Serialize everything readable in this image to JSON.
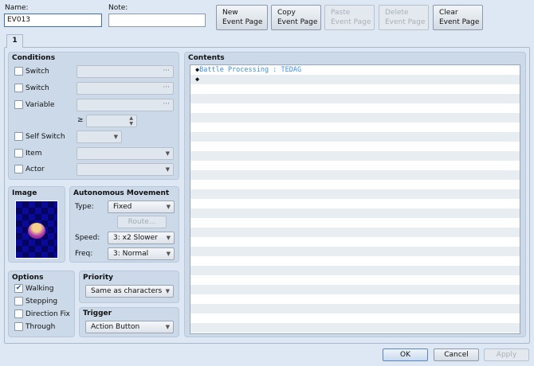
{
  "header": {
    "name_label": "Name:",
    "name_value": "EV013",
    "note_label": "Note:",
    "note_value": "",
    "buttons": [
      {
        "label": "New\nEvent Page",
        "enabled": true
      },
      {
        "label": "Copy\nEvent Page",
        "enabled": true
      },
      {
        "label": "Paste\nEvent Page",
        "enabled": false
      },
      {
        "label": "Delete\nEvent Page",
        "enabled": false
      },
      {
        "label": "Clear\nEvent Page",
        "enabled": true
      }
    ]
  },
  "tabs": [
    {
      "label": "1"
    }
  ],
  "conditions": {
    "title": "Conditions",
    "switch1": "Switch",
    "switch2": "Switch",
    "variable": "Variable",
    "gte": "≥",
    "self_switch": "Self Switch",
    "item": "Item",
    "actor": "Actor",
    "dots": "···"
  },
  "image": {
    "title": "Image"
  },
  "movement": {
    "title": "Autonomous Movement",
    "type_label": "Type:",
    "type_value": "Fixed",
    "route": "Route...",
    "speed_label": "Speed:",
    "speed_value": "3: x2 Slower",
    "freq_label": "Freq:",
    "freq_value": "3: Normal"
  },
  "options": {
    "title": "Options",
    "items": [
      {
        "label": "Walking",
        "checked": true
      },
      {
        "label": "Stepping",
        "checked": false
      },
      {
        "label": "Direction Fix",
        "checked": false
      },
      {
        "label": "Through",
        "checked": false
      }
    ]
  },
  "priority": {
    "title": "Priority",
    "value": "Same as characters"
  },
  "trigger": {
    "title": "Trigger",
    "value": "Action Button"
  },
  "contents": {
    "title": "Contents",
    "commands": [
      {
        "text": "Battle Processing : TEDAG",
        "color": "#3a8ee0"
      },
      {
        "text": "",
        "color": "#000000"
      }
    ]
  },
  "footer": {
    "ok": "OK",
    "cancel": "Cancel",
    "apply": "Apply"
  }
}
